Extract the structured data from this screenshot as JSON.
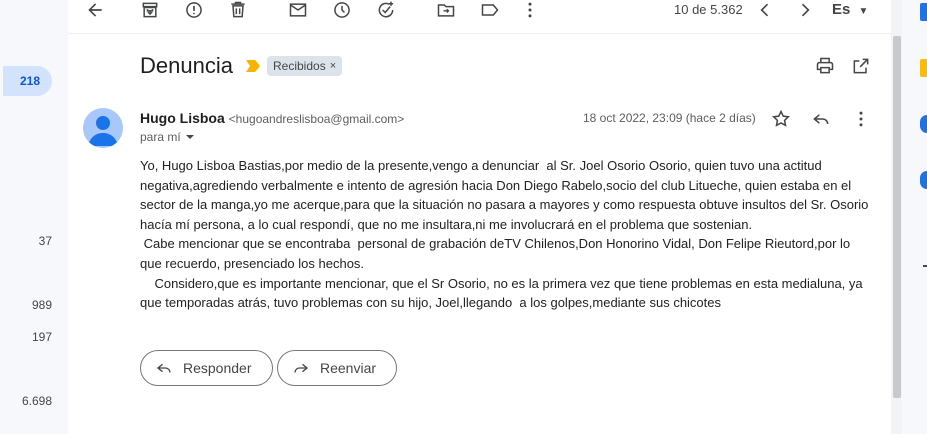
{
  "toolbar": {
    "pager": "10 de 5.362",
    "lang": "Es",
    "icons": [
      "back-icon",
      "archive-icon",
      "report-spam-icon",
      "delete-icon",
      "mark-unread-icon",
      "snooze-icon",
      "add-task-icon",
      "move-to-icon",
      "label-icon",
      "more-icon",
      "prev-icon",
      "next-icon"
    ]
  },
  "counts": [
    "218",
    "37",
    "989",
    "197",
    "6.698"
  ],
  "email": {
    "subject": "Denuncia",
    "label": "Recibidos",
    "label_close": "×",
    "sender_name": "Hugo Lisboa",
    "sender_email": "<hugoandreslisboa@gmail.com>",
    "to": "para mí",
    "date": "18 oct 2022, 23:09 (hace 2 días)",
    "body": "Yo, Hugo Lisboa Bastias,por medio de la presente,vengo a denunciar  al Sr. Joel Osorio Osorio, quien tuvo una actitud negativa,agrediendo verbalmente e intento de agresión hacia Don Diego Rabelo,socio del club Litueche, quien estaba en el sector de la manga,yo me acerque,para que la situación no pasara a mayores y como respuesta obtuve insultos del Sr. Osorio hacía mí persona, a lo cual respondí, que no me insultara,ni me involucrará en el problema que sostenian.\n Cabe mencionar que se encontraba  personal de grabación deTV Chilenos,Don Honorino Vidal, Don Felipe Rieutord,por lo que recuerdo, presenciado los hechos.\n    Considero,que es importante mencionar, que el Sr Osorio, no es la primera vez que tiene problemas en esta medialuna, ya que temporadas atrás, tuvo problemas con su hijo, Joel,llegando  a los golpes,mediante sus chicotes"
  },
  "actions": {
    "reply": "Responder",
    "forward": "Reenviar"
  },
  "colors": {
    "label_arrow": "#f4b400",
    "active_count_bg": "#d3e3fd",
    "active_count_text": "#0b57d0",
    "avatar_bg": "#a8c7fa",
    "avatar_fg": "#1a73e8"
  }
}
